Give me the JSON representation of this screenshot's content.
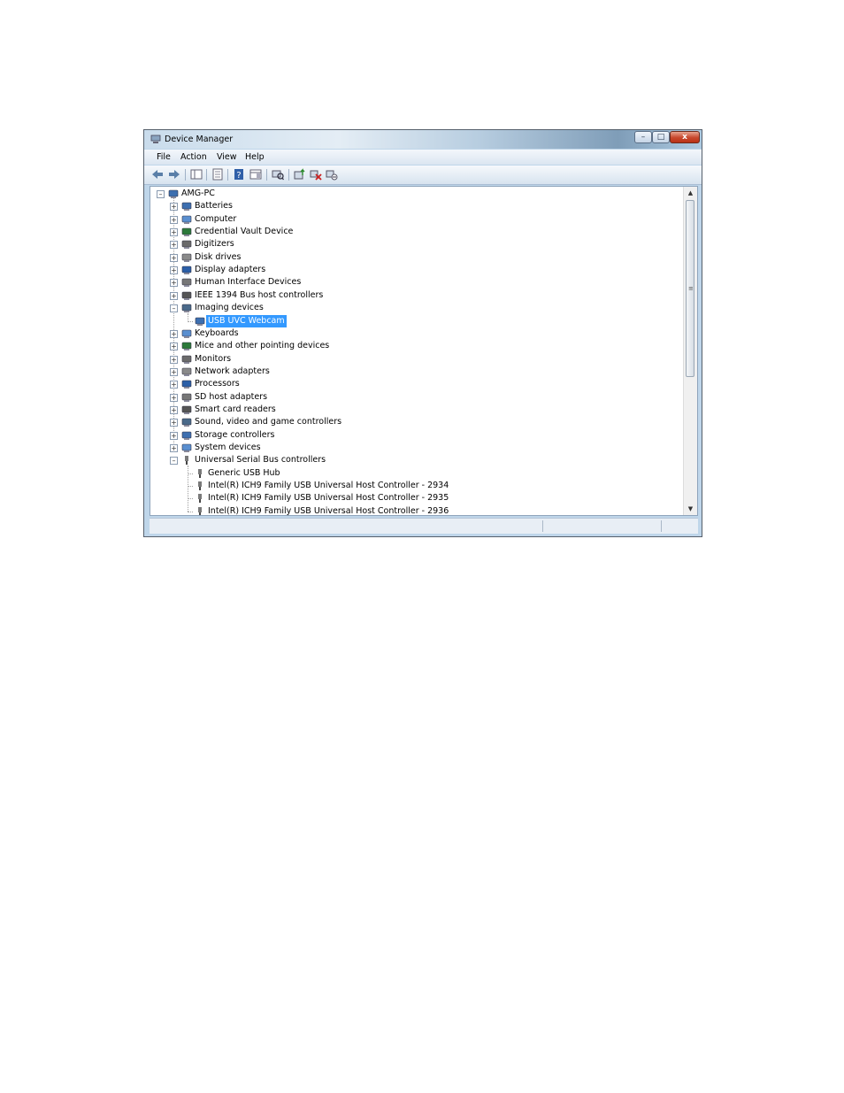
{
  "window": {
    "title": "Device Manager"
  },
  "menu": {
    "file": "File",
    "action": "Action",
    "view": "View",
    "help": "Help"
  },
  "window_controls": {
    "minimize": "–",
    "maximize": "□",
    "close": "x"
  },
  "toolbar": {
    "icons": [
      "back-icon",
      "forward-icon",
      "show-hide-tree-icon",
      "properties-icon",
      "help-icon",
      "show-hide-action-pane-icon",
      "scan-hardware-icon",
      "update-driver-icon",
      "uninstall-icon",
      "disable-device-icon"
    ]
  },
  "tree": {
    "root": "AMG-PC",
    "items": [
      {
        "label": "Batteries",
        "icon": "battery-icon"
      },
      {
        "label": "Computer",
        "icon": "computer-icon"
      },
      {
        "label": "Credential Vault Device",
        "icon": "credential-icon"
      },
      {
        "label": "Digitizers",
        "icon": "digitizer-icon"
      },
      {
        "label": "Disk drives",
        "icon": "disk-drive-icon"
      },
      {
        "label": "Display adapters",
        "icon": "display-adapter-icon"
      },
      {
        "label": "Human Interface Devices",
        "icon": "hid-icon"
      },
      {
        "label": "IEEE 1394 Bus host controllers",
        "icon": "ieee1394-icon"
      },
      {
        "label": "Imaging devices",
        "icon": "camera-icon",
        "expanded": true
      },
      {
        "label": "USB UVC Webcam",
        "icon": "webcam-icon",
        "child": true,
        "selected": true
      },
      {
        "label": "Keyboards",
        "icon": "keyboard-icon"
      },
      {
        "label": "Mice and other pointing devices",
        "icon": "mouse-icon"
      },
      {
        "label": "Monitors",
        "icon": "monitor-icon"
      },
      {
        "label": "Network adapters",
        "icon": "network-icon"
      },
      {
        "label": "Processors",
        "icon": "processor-icon"
      },
      {
        "label": "SD host adapters",
        "icon": "sd-card-icon"
      },
      {
        "label": "Smart card readers",
        "icon": "smart-card-icon"
      },
      {
        "label": "Sound, video and game controllers",
        "icon": "speaker-icon"
      },
      {
        "label": "Storage controllers",
        "icon": "storage-icon"
      },
      {
        "label": "System devices",
        "icon": "system-icon"
      },
      {
        "label": "Universal Serial Bus controllers",
        "icon": "usb-icon",
        "expanded": true
      },
      {
        "label": "Generic USB Hub",
        "icon": "usb-icon",
        "child": true
      },
      {
        "label": "Intel(R) ICH9 Family USB Universal Host Controller - 2934",
        "icon": "usb-icon",
        "child": true
      },
      {
        "label": "Intel(R) ICH9 Family USB Universal Host Controller - 2935",
        "icon": "usb-icon",
        "child": true
      },
      {
        "label": "Intel(R) ICH9 Family USB Universal Host Controller - 2936",
        "icon": "usb-icon",
        "child": true
      }
    ]
  },
  "scrollbar": {
    "up": "▲",
    "down": "▼",
    "grip": "≡",
    "position": 0.0
  },
  "colors": {
    "selection": "#3399ff",
    "titlebar": "#c9dcec"
  }
}
